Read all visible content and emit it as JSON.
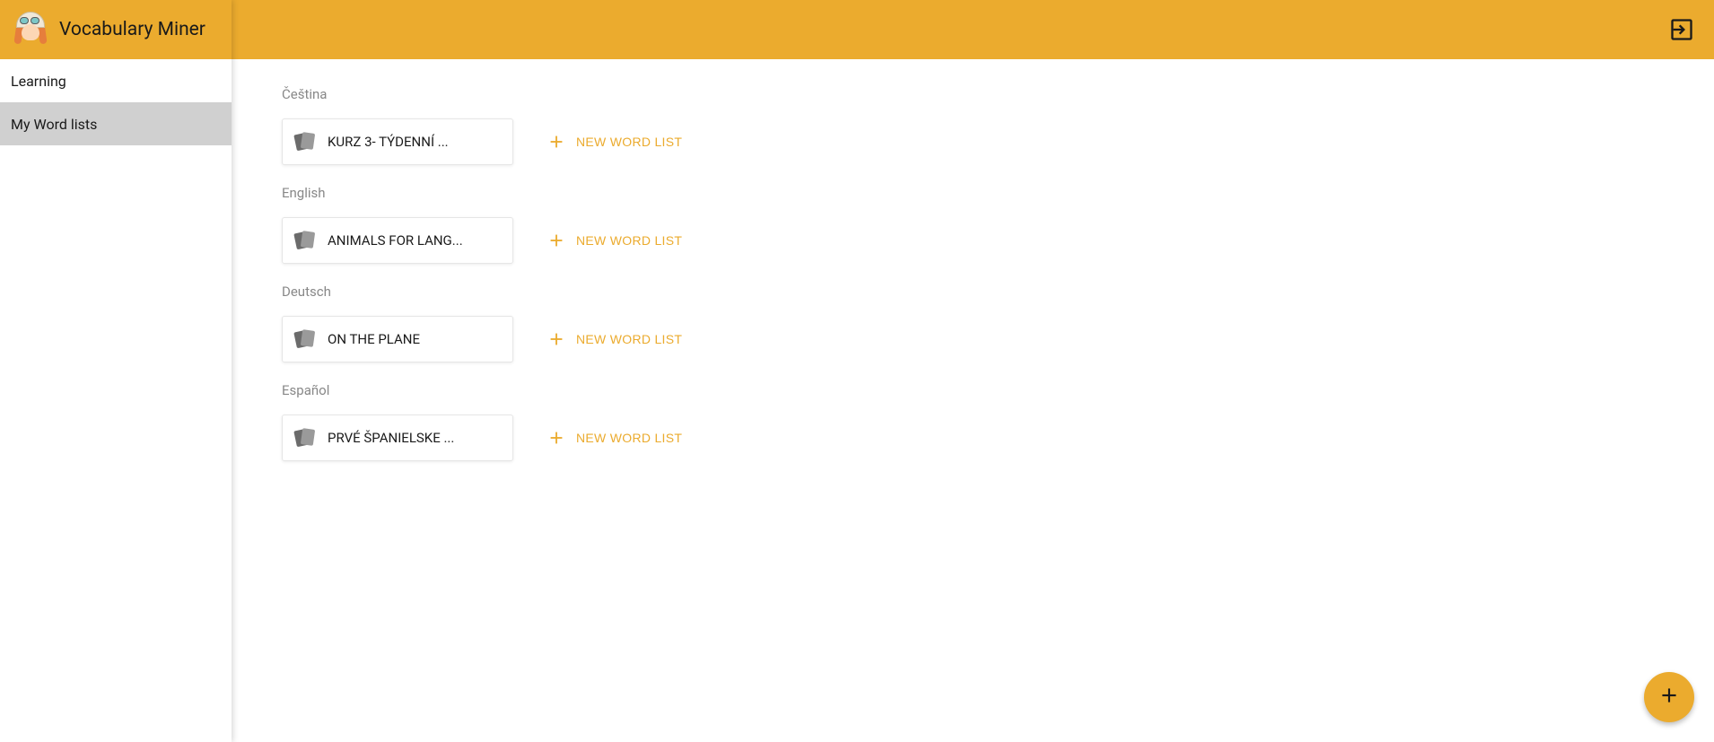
{
  "app": {
    "title": "Vocabulary Miner"
  },
  "sidebar": {
    "items": [
      {
        "label": "Learning",
        "active": false
      },
      {
        "label": "My Word lists",
        "active": true
      }
    ]
  },
  "colors": {
    "accent": "#ebab2e"
  },
  "buttons": {
    "new_word_list": "NEW WORD LIST"
  },
  "languages": [
    {
      "name": "Čeština",
      "lists": [
        {
          "title": "KURZ 3- TÝDENNÍ ..."
        }
      ]
    },
    {
      "name": "English",
      "lists": [
        {
          "title": "ANIMALS FOR LANG..."
        }
      ]
    },
    {
      "name": "Deutsch",
      "lists": [
        {
          "title": "ON THE PLANE"
        }
      ]
    },
    {
      "name": "Español",
      "lists": [
        {
          "title": "PRVÉ ŠPANIELSKE ..."
        }
      ]
    }
  ]
}
